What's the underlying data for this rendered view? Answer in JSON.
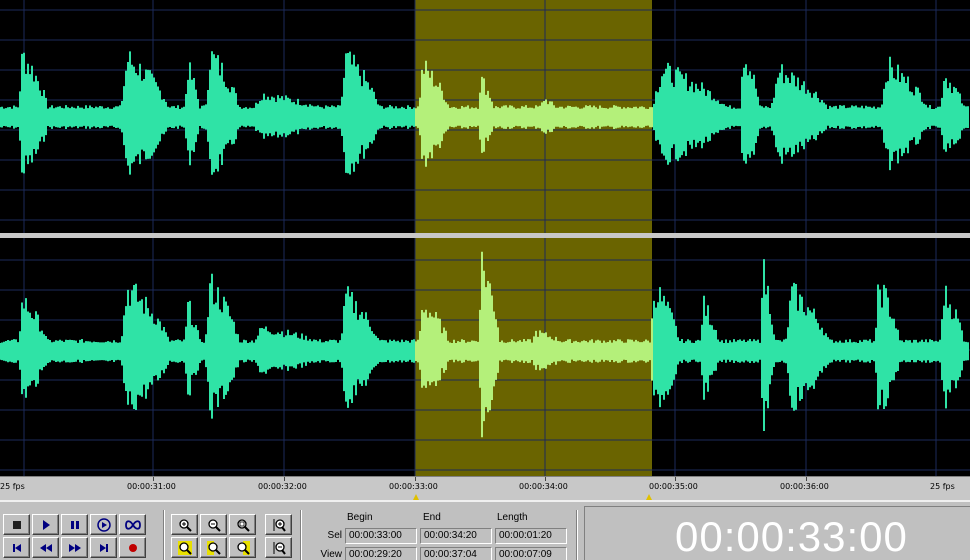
{
  "colors": {
    "waveform": "#2fe3a6",
    "waveform_selected": "#b4f07a",
    "background": "#000000",
    "selection_bg": "#6a6400",
    "grid": "#1c2a5a",
    "divider": "#c8c8c8"
  },
  "ruler": {
    "left_label": "25 fps",
    "right_label": "25 fps",
    "ticks": [
      "00:00:31:00",
      "00:00:32:00",
      "00:00:33:00",
      "00:00:34:00",
      "00:00:35:00",
      "00:00:36:00"
    ]
  },
  "transport": {
    "buttons_row1": [
      "stop-icon",
      "play-icon",
      "pause-icon",
      "play-to-end-icon",
      "loop-icon"
    ],
    "buttons_row2": [
      "go-to-start-icon",
      "rewind-icon",
      "fast-forward-icon",
      "go-to-end-icon",
      "record-icon"
    ]
  },
  "zoom": {
    "buttons_row1": [
      "zoom-in-icon",
      "zoom-out-icon",
      "zoom-full-icon",
      "zoom-in-vertical-icon"
    ],
    "buttons_row2": [
      "zoom-to-selection-icon",
      "zoom-left-icon",
      "zoom-right-icon",
      "zoom-out-vertical-icon"
    ]
  },
  "selection": {
    "headers": {
      "begin": "Begin",
      "end": "End",
      "length": "Length"
    },
    "sel": {
      "label": "Sel",
      "begin": "00:00:33:00",
      "end": "00:00:34:20",
      "length": "00:00:01:20"
    },
    "view": {
      "label": "View",
      "begin": "00:00:29:20",
      "end": "00:00:37:04",
      "length": "00:00:07:09"
    }
  },
  "time_display": "00:00:33:00"
}
